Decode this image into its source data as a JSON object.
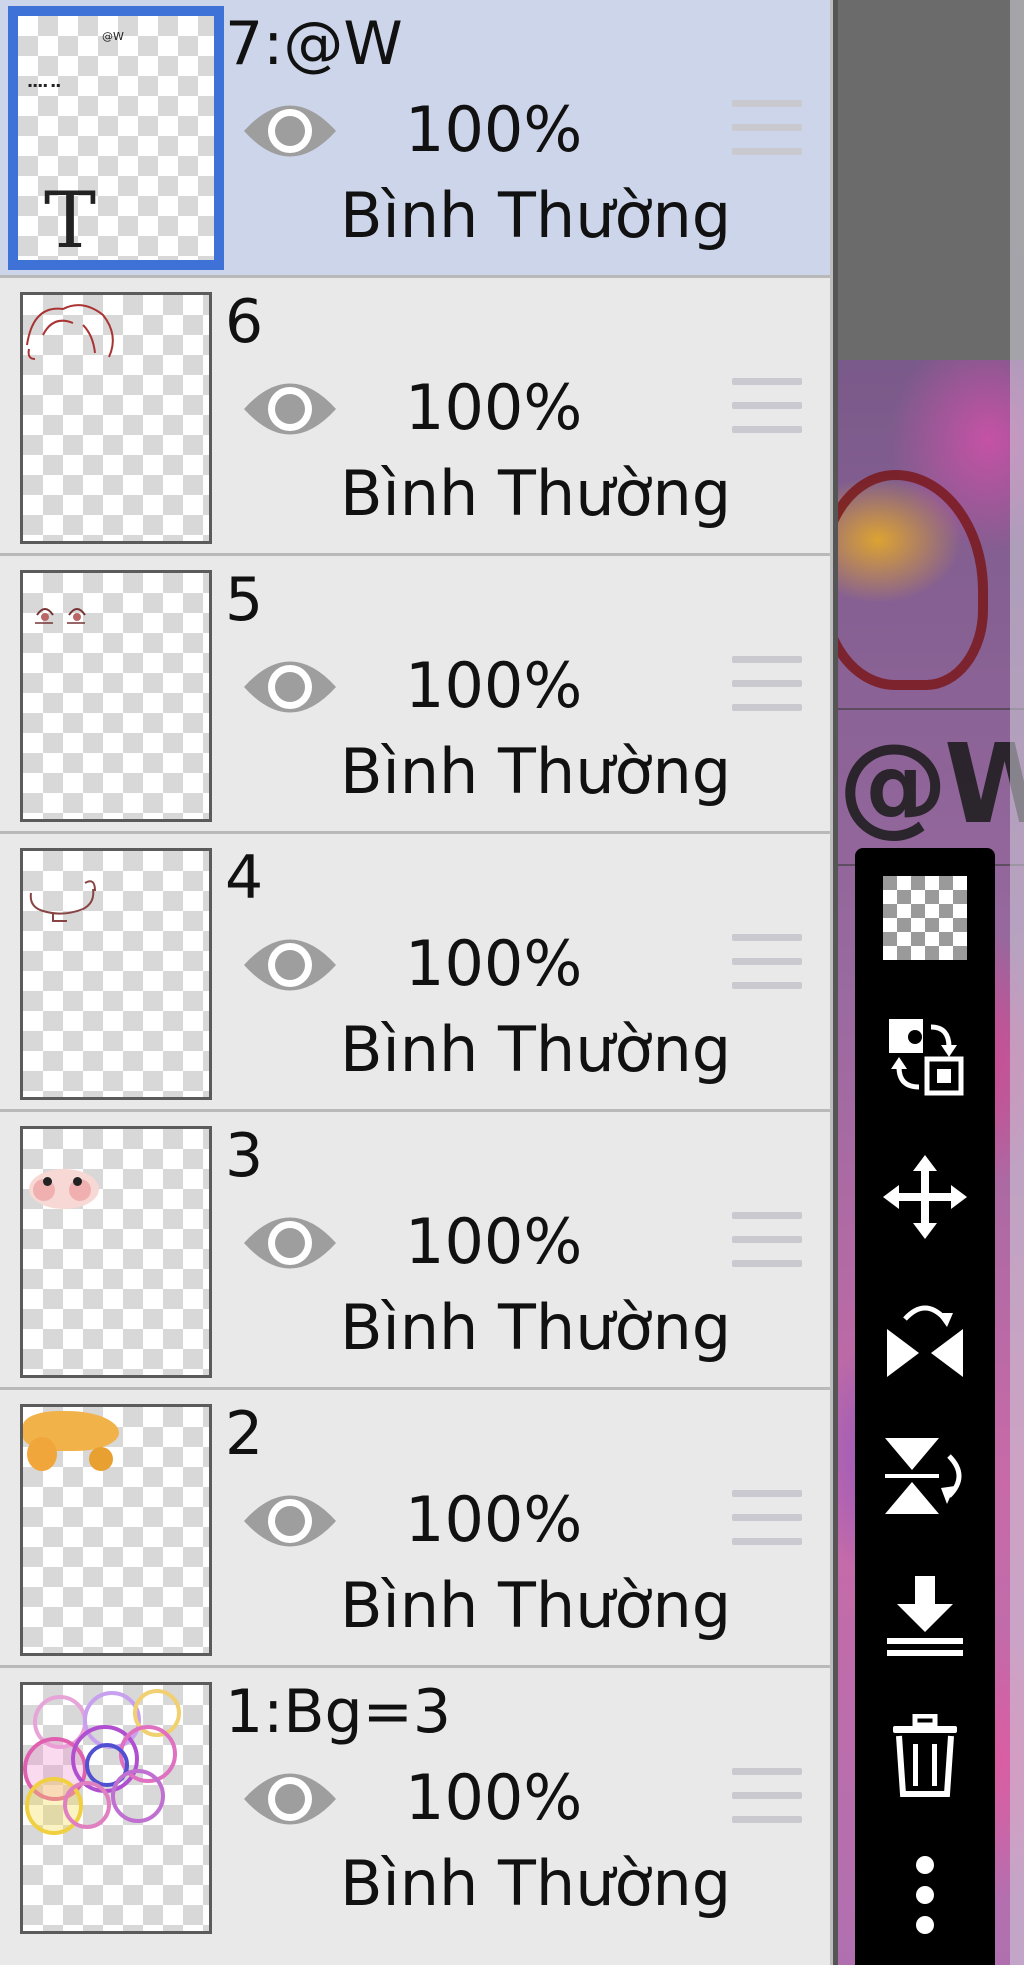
{
  "layers": [
    {
      "name": "7:@W",
      "opacity": "100%",
      "blend": "Bình Thường",
      "visible": true,
      "selected": true,
      "thumb": "text-layer",
      "thumb_text": "T",
      "thumb_caption": "@W"
    },
    {
      "name": "6",
      "opacity": "100%",
      "blend": "Bình Thường",
      "visible": true,
      "selected": false,
      "thumb": "hair-sketch"
    },
    {
      "name": "5",
      "opacity": "100%",
      "blend": "Bình Thường",
      "visible": true,
      "selected": false,
      "thumb": "eyes"
    },
    {
      "name": "4",
      "opacity": "100%",
      "blend": "Bình Thường",
      "visible": true,
      "selected": false,
      "thumb": "outline"
    },
    {
      "name": "3",
      "opacity": "100%",
      "blend": "Bình Thường",
      "visible": true,
      "selected": false,
      "thumb": "face-blush"
    },
    {
      "name": "2",
      "opacity": "100%",
      "blend": "Bình Thường",
      "visible": true,
      "selected": false,
      "thumb": "hair-color"
    },
    {
      "name": "1:Bg=3",
      "opacity": "100%",
      "blend": "Bình Thường",
      "visible": true,
      "selected": false,
      "thumb": "background-circles"
    }
  ],
  "canvas": {
    "overlay_text": "@W"
  },
  "toolbar": {
    "tools": [
      "transparency-icon",
      "swap-layers-icon",
      "move-icon",
      "flip-horizontal-icon",
      "flip-vertical-icon",
      "merge-down-icon",
      "delete-icon",
      "more-icon"
    ]
  },
  "colors": {
    "selected_row": "#cdd5ea",
    "selection_border": "#3f72d6",
    "panel_bg": "#e9e9e9",
    "toolbar_bg": "#000000"
  }
}
